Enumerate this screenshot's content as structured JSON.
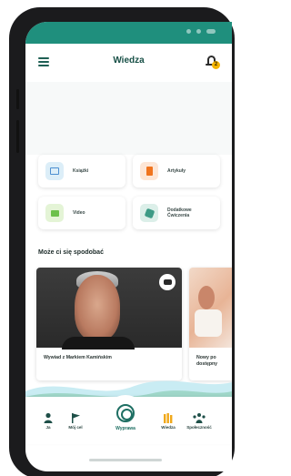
{
  "colors": {
    "brand_teal": "#1f8f7d",
    "title_text": "#174f46",
    "badge_yellow": "#f4b400"
  },
  "header": {
    "title": "Wiedza",
    "notification_count": "2"
  },
  "categories": [
    {
      "label": "Książki",
      "icon": "book-icon"
    },
    {
      "label": "Artykuły",
      "icon": "article-icon"
    },
    {
      "label": "Video",
      "icon": "video-icon"
    },
    {
      "label": "Dodatkowe Ćwiczenia",
      "icon": "puzzle-icon"
    }
  ],
  "recommended": {
    "title": "Może ci się spodobać",
    "items": [
      {
        "caption": "Wywiad z Markiem Kamińskim",
        "type": "video"
      },
      {
        "caption": "Nowy po dostępny"
      }
    ]
  },
  "bottom_nav": [
    {
      "label": "Ja",
      "icon": "person-icon"
    },
    {
      "label": "Mój cel",
      "icon": "flag-icon"
    },
    {
      "label": "Wyprawa",
      "icon": "swirl-icon"
    },
    {
      "label": "Wiedza",
      "icon": "books-icon"
    },
    {
      "label": "Społeczność",
      "icon": "community-icon"
    }
  ]
}
